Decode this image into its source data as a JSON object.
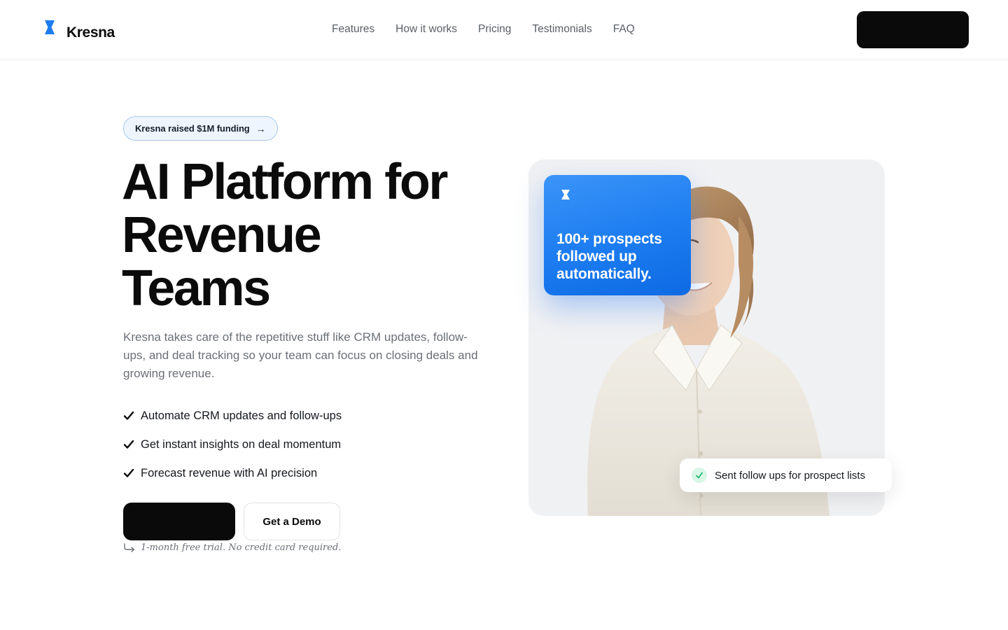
{
  "brand": {
    "name": "Kresna",
    "accent": "#1c7cf0"
  },
  "nav": {
    "items": [
      {
        "label": "Features"
      },
      {
        "label": "How it works"
      },
      {
        "label": "Pricing"
      },
      {
        "label": "Testimonials"
      },
      {
        "label": "FAQ"
      }
    ],
    "cta_label": ""
  },
  "hero": {
    "badge": {
      "label": "Kresna raised $1M funding",
      "icon": "arrow-right-icon"
    },
    "headline_lines": [
      "AI Platform for",
      "Revenue",
      "Teams"
    ],
    "subtext": "Kresna takes care of the repetitive stuff like CRM updates, follow-ups, and deal tracking so your team can focus on closing deals and growing revenue.",
    "features": [
      "Automate CRM updates and follow-ups",
      "Get instant insights on deal momentum",
      "Forecast revenue with AI precision"
    ],
    "primary_cta_label": "",
    "secondary_cta_label": "Get a Demo",
    "trial_note": "1-month free trial. No credit card required."
  },
  "visual": {
    "stat_card_text": "100+ prospects followed up automatically.",
    "toast_text": "Sent follow ups for prospect lists",
    "toast_icon": "check-icon",
    "toast_icon_color": "#1fb872"
  }
}
